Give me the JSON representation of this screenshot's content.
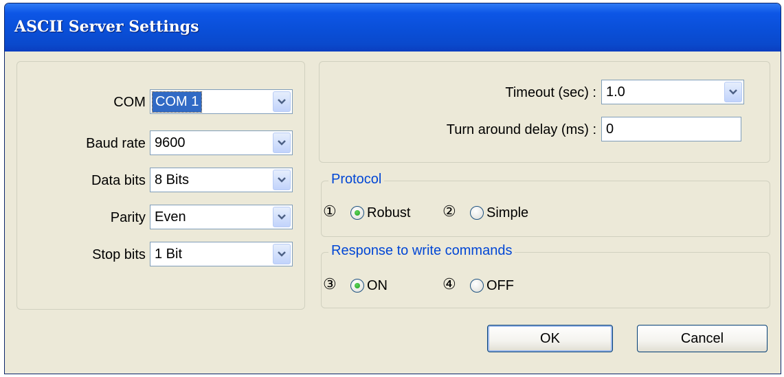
{
  "window": {
    "title": "ASCII Server Settings"
  },
  "serial": {
    "com": {
      "label": "COM :",
      "value": "COM 1"
    },
    "baud": {
      "label": "Baud rate :",
      "value": "9600"
    },
    "data_bits": {
      "label": "Data bits :",
      "value": "8 Bits"
    },
    "parity": {
      "label": "Parity :",
      "value": "Even"
    },
    "stop_bits": {
      "label": "Stop bits :",
      "value": "1 Bit"
    }
  },
  "timing": {
    "timeout": {
      "label": "Timeout (sec) :",
      "value": "1.0"
    },
    "turn_around": {
      "label": "Turn around delay (ms) :",
      "value": "0"
    }
  },
  "protocol": {
    "title": "Protocol",
    "options": [
      {
        "marker": "①",
        "label": "Robust",
        "selected": true
      },
      {
        "marker": "②",
        "label": "Simple",
        "selected": false
      }
    ]
  },
  "response": {
    "title": "Response to write commands",
    "options": [
      {
        "marker": "③",
        "label": "ON",
        "selected": true
      },
      {
        "marker": "④",
        "label": "OFF",
        "selected": false
      }
    ]
  },
  "buttons": {
    "ok": "OK",
    "cancel": "Cancel"
  },
  "icons": {
    "dropdown": "chevron-down-icon",
    "radio_selected": "radio-selected-icon",
    "radio_unselected": "radio-unselected-icon"
  },
  "colors": {
    "title_bar": "#0a4fd8",
    "group_title": "#0046d5",
    "selection": "#316ac5",
    "radio_dot": "#21a121",
    "dialog_bg": "#ece9d8"
  }
}
